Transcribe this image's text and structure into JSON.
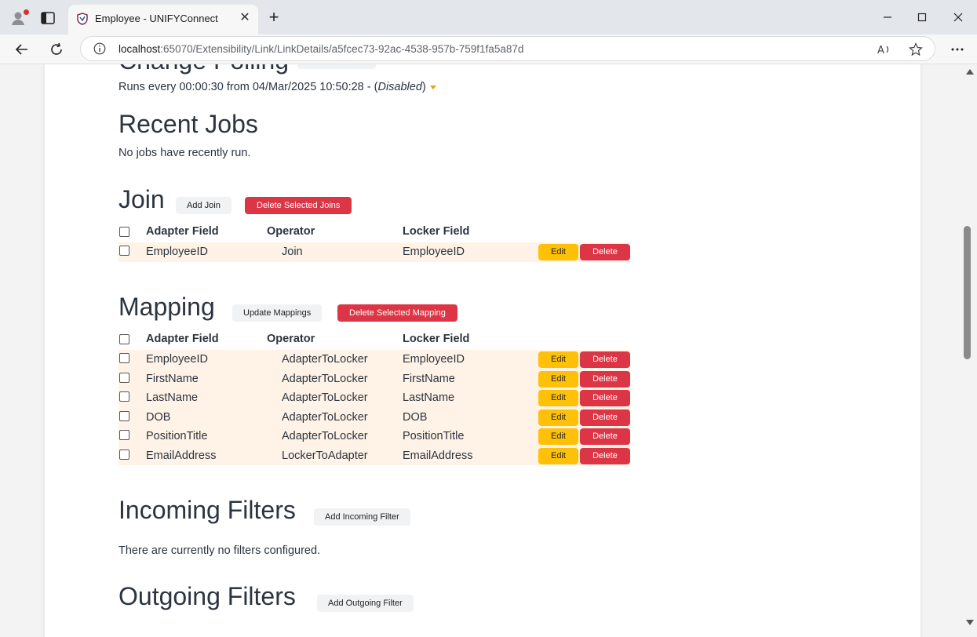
{
  "browser": {
    "tab_title": "Employee - UNIFYConnect",
    "tab_close": "✕",
    "new_tab": "+",
    "url_host": "localhost",
    "url_rest": ":65070/Extensibility/Link/LinkDetails/a5fcec73-92ac-4538-957b-759f1fa5a87d"
  },
  "change_polling": {
    "heading": "Change Polling",
    "summary_prefix": "Runs every 00:00:30 from 04/Mar/2025 10:50:28 - (",
    "summary_status": "Disabled",
    "summary_suffix": ")"
  },
  "recent_jobs": {
    "heading": "Recent Jobs",
    "empty_text": "No jobs have recently run."
  },
  "join": {
    "heading": "Join",
    "add_label": "Add Join",
    "delete_selected_label": "Delete Selected Joins",
    "columns": {
      "adapter": "Adapter Field",
      "operator": "Operator",
      "locker": "Locker Field"
    },
    "rows": [
      {
        "adapter": "EmployeeID",
        "operator": "Join",
        "locker": "EmployeeID"
      }
    ]
  },
  "mapping": {
    "heading": "Mapping",
    "update_label": "Update Mappings",
    "delete_selected_label": "Delete Selected Mapping",
    "columns": {
      "adapter": "Adapter Field",
      "operator": "Operator",
      "locker": "Locker Field"
    },
    "rows": [
      {
        "adapter": "EmployeeID",
        "operator": "AdapterToLocker",
        "locker": "EmployeeID"
      },
      {
        "adapter": "FirstName",
        "operator": "AdapterToLocker",
        "locker": "FirstName"
      },
      {
        "adapter": "LastName",
        "operator": "AdapterToLocker",
        "locker": "LastName"
      },
      {
        "adapter": "DOB",
        "operator": "AdapterToLocker",
        "locker": "DOB"
      },
      {
        "adapter": "PositionTitle",
        "operator": "AdapterToLocker",
        "locker": "PositionTitle"
      },
      {
        "adapter": "EmailAddress",
        "operator": "LockerToAdapter",
        "locker": "EmailAddress"
      }
    ]
  },
  "row_actions": {
    "edit_label": "Edit",
    "delete_label": "Delete"
  },
  "incoming_filters": {
    "heading": "Incoming Filters",
    "add_label": "Add Incoming Filter",
    "empty_text": "There are currently no filters configured."
  },
  "outgoing_filters": {
    "heading": "Outgoing Filters",
    "add_label": "Add Outgoing Filter"
  },
  "colors": {
    "danger": "#dc3545",
    "warning": "#ffc107",
    "row_highlight": "#fef3e6",
    "caret": "#e8a317"
  }
}
